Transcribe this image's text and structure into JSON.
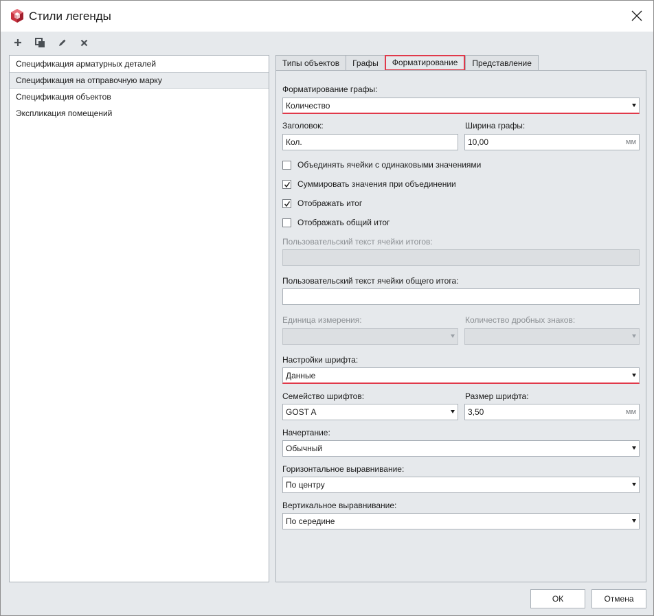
{
  "window": {
    "title": "Стили легенды"
  },
  "toolbar": {
    "add_icon": "plus-icon",
    "copy_icon": "copy-icon",
    "edit_icon": "pencil-icon",
    "delete_icon": "cross-icon"
  },
  "styles_list": [
    "Спецификация арматурных деталей",
    "Спецификация на отправочную марку",
    "Спецификация объектов",
    "Экспликация помещений"
  ],
  "tabs": [
    "Типы объектов",
    "Графы",
    "Форматирование",
    "Представление"
  ],
  "form": {
    "column_format_label": "Форматирование графы:",
    "column_format_value": "Количество",
    "header_label": "Заголовок:",
    "header_value": "Кол.",
    "width_label": "Ширина графы:",
    "width_value": "10,00",
    "width_unit": "мм",
    "merge_cells_label": "Объединять ячейки с одинаковыми значениями",
    "sum_values_label": "Суммировать значения при объединении",
    "show_total_label": "Отображать итог",
    "show_grand_total_label": "Отображать общий итог",
    "total_text_label": "Пользовательский текст ячейки итогов:",
    "total_text_value": "",
    "grand_total_text_label": "Пользовательский текст ячейки общего итога:",
    "grand_total_text_value": "",
    "unit_label": "Единица измерения:",
    "unit_value": "",
    "decimals_label": "Количество дробных знаков:",
    "decimals_value": "",
    "font_settings_label": "Настройки шрифта:",
    "font_settings_value": "Данные",
    "font_family_label": "Семейство шрифтов:",
    "font_family_value": "GOST A",
    "font_size_label": "Размер шрифта:",
    "font_size_value": "3,50",
    "font_size_unit": "мм",
    "style_label": "Начертание:",
    "style_value": "Обычный",
    "halign_label": "Горизонтальное выравнивание:",
    "halign_value": "По центру",
    "valign_label": "Вертикальное выравнивание:",
    "valign_value": "По середине"
  },
  "checkboxes": {
    "merge_cells": false,
    "sum_values": true,
    "show_total": true,
    "show_grand_total": false
  },
  "buttons": {
    "ok": "ОК",
    "cancel": "Отмена"
  },
  "colors": {
    "accent": "#e0394a",
    "background": "#e6e9ec"
  }
}
